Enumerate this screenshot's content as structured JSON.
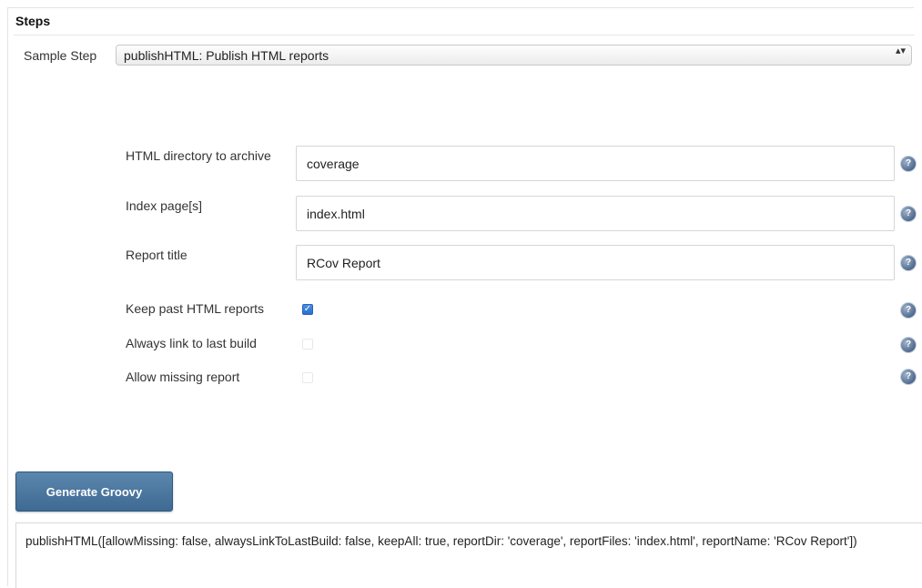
{
  "section": {
    "title": "Steps"
  },
  "sample_step": {
    "label": "Sample Step",
    "selected": "publishHTML: Publish HTML reports",
    "arrows": "▴▾"
  },
  "fields": {
    "html_dir": {
      "label": "HTML directory to archive",
      "value": "coverage"
    },
    "index_pages": {
      "label": "Index page[s]",
      "value": "index.html"
    },
    "report_title": {
      "label": "Report title",
      "value": "RCov Report"
    }
  },
  "options": {
    "keep_past": {
      "label": "Keep past HTML reports",
      "checked": true
    },
    "always_link": {
      "label": "Always link to last build",
      "checked": false
    },
    "allow_missing": {
      "label": "Allow missing report",
      "checked": false
    }
  },
  "help_glyph": "?",
  "check_glyph": "✓",
  "icons": {
    "help": "help-icon",
    "checkbox": "checkbox"
  },
  "button": {
    "label": "Generate Groovy"
  },
  "output": {
    "text": "publishHTML([allowMissing: false, alwaysLinkToLastBuild: false, keepAll: true, reportDir: 'coverage', reportFiles: 'index.html', reportName: 'RCov Report'])"
  },
  "colors": {
    "button": "#3e6a93",
    "checkbox": "#2a6fd1",
    "help": "#4f6a8f"
  }
}
